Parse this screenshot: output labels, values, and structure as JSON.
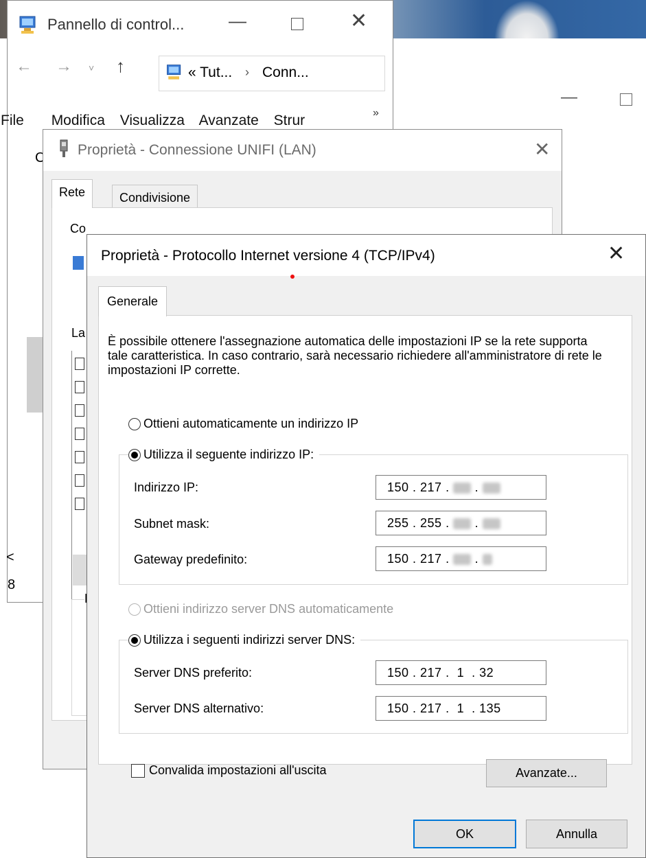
{
  "control_panel": {
    "title": "Pannello di control...",
    "breadcrumb": [
      "« Tut...",
      "Conn..."
    ],
    "menu": [
      "File",
      "Modifica",
      "Visualizza",
      "Avanzate",
      "Strur"
    ],
    "more_menu": "»",
    "partial_label": "C",
    "scroll_left": "<",
    "partial_bottom": "8"
  },
  "lan_dialog": {
    "title": "Proprietà - Connessione UNIFI (LAN)",
    "tabs": [
      "Rete",
      "Condivisione"
    ],
    "active_tab": "Rete",
    "partial_label_connect": "Co",
    "partial_label_list": "La",
    "partial_group": "D"
  },
  "ipv4_dialog": {
    "title": "Proprietà - Protocollo Internet versione 4 (TCP/IPv4)",
    "tab": "Generale",
    "intro": "È possibile ottenere l'assegnazione automatica delle impostazioni IP se la rete supporta tale caratteristica. In caso contrario, sarà necessario richiedere all'amministratore di rete le impostazioni IP corrette.",
    "ip_auto_label": "Ottieni automaticamente un indirizzo IP",
    "ip_manual_label": "Utilizza il seguente indirizzo IP:",
    "ip_mode": "manual",
    "fields": {
      "ip_label": "Indirizzo IP:",
      "ip_value": "150 . 217 .",
      "subnet_label": "Subnet mask:",
      "subnet_value": "255 . 255 .",
      "gateway_label": "Gateway predefinito:",
      "gateway_value": "150 . 217 ."
    },
    "dns_auto_label": "Ottieni indirizzo server DNS automaticamente",
    "dns_manual_label": "Utilizza i seguenti indirizzi server DNS:",
    "dns_mode": "manual",
    "dns": {
      "preferred_label": "Server DNS preferito:",
      "preferred_value": "150 . 217 .  1  . 32",
      "alternate_label": "Server DNS alternativo:",
      "alternate_value": "150 . 217 .  1  . 135"
    },
    "validate_label": "Convalida impostazioni all'uscita",
    "validate_checked": false,
    "advanced_button": "Avanzate...",
    "ok_button": "OK",
    "cancel_button": "Annulla"
  },
  "colors": {
    "dialog_bg": "#f0f0f0",
    "default_button_border": "#0078d7",
    "disabled_text": "#9a9a9a"
  }
}
